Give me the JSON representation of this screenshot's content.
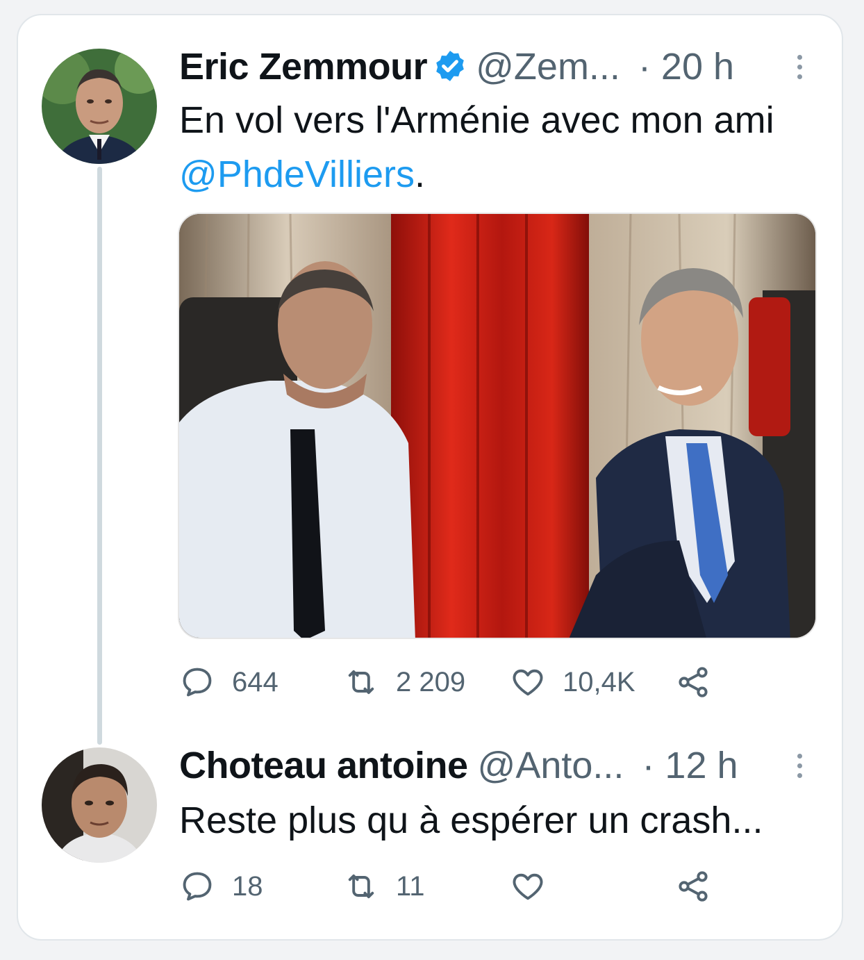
{
  "tweet": {
    "author_name": "Eric Zemmour",
    "author_handle": "@Zem...",
    "time": "· 20 h",
    "text_before": "En vol vers l'Arménie avec mon ami ",
    "mention": "@PhdeVilliers",
    "text_after": ".",
    "verified": true,
    "stats": {
      "replies": "644",
      "retweets": "2 209",
      "likes": "10,4K"
    }
  },
  "reply": {
    "author_name": "Choteau antoine",
    "author_handle": "@Anto...",
    "time": "· 12 h",
    "text": "Reste plus qu à espérer un crash...",
    "stats": {
      "replies": "18",
      "retweets": "11",
      "likes": ""
    }
  },
  "colors": {
    "accent": "#1d9bf0",
    "secondary_text": "#536471",
    "thread_line": "#cfd9de"
  }
}
